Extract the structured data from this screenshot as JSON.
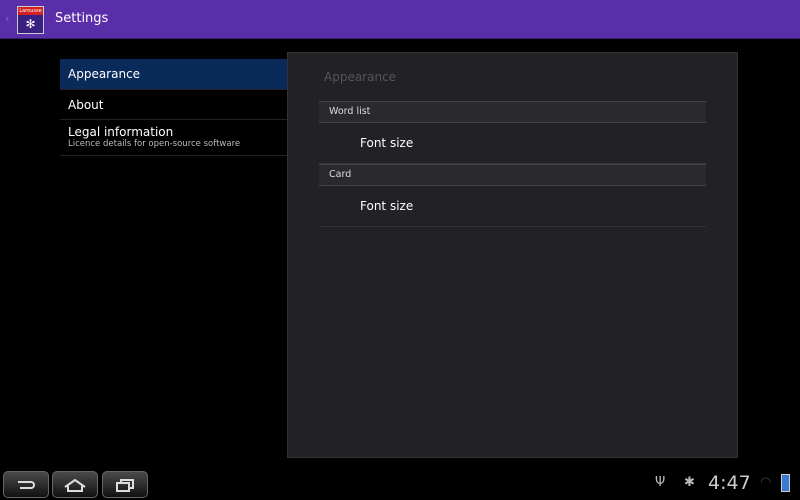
{
  "action_bar": {
    "title": "Settings",
    "logo_text": "Larousse"
  },
  "headers": [
    {
      "label": "Appearance"
    },
    {
      "label": "About"
    },
    {
      "label": "Legal information",
      "summary": "Licence details for open-source software"
    }
  ],
  "panel": {
    "title": "Appearance",
    "categories": [
      {
        "label": "Word list",
        "pref": "Font size"
      },
      {
        "label": "Card",
        "pref": "Font size"
      }
    ]
  },
  "status": {
    "time": "4:47"
  },
  "colors": {
    "action_bar": "#5a2ea8",
    "selected": "#0a2a5a",
    "panel": "#222226"
  }
}
